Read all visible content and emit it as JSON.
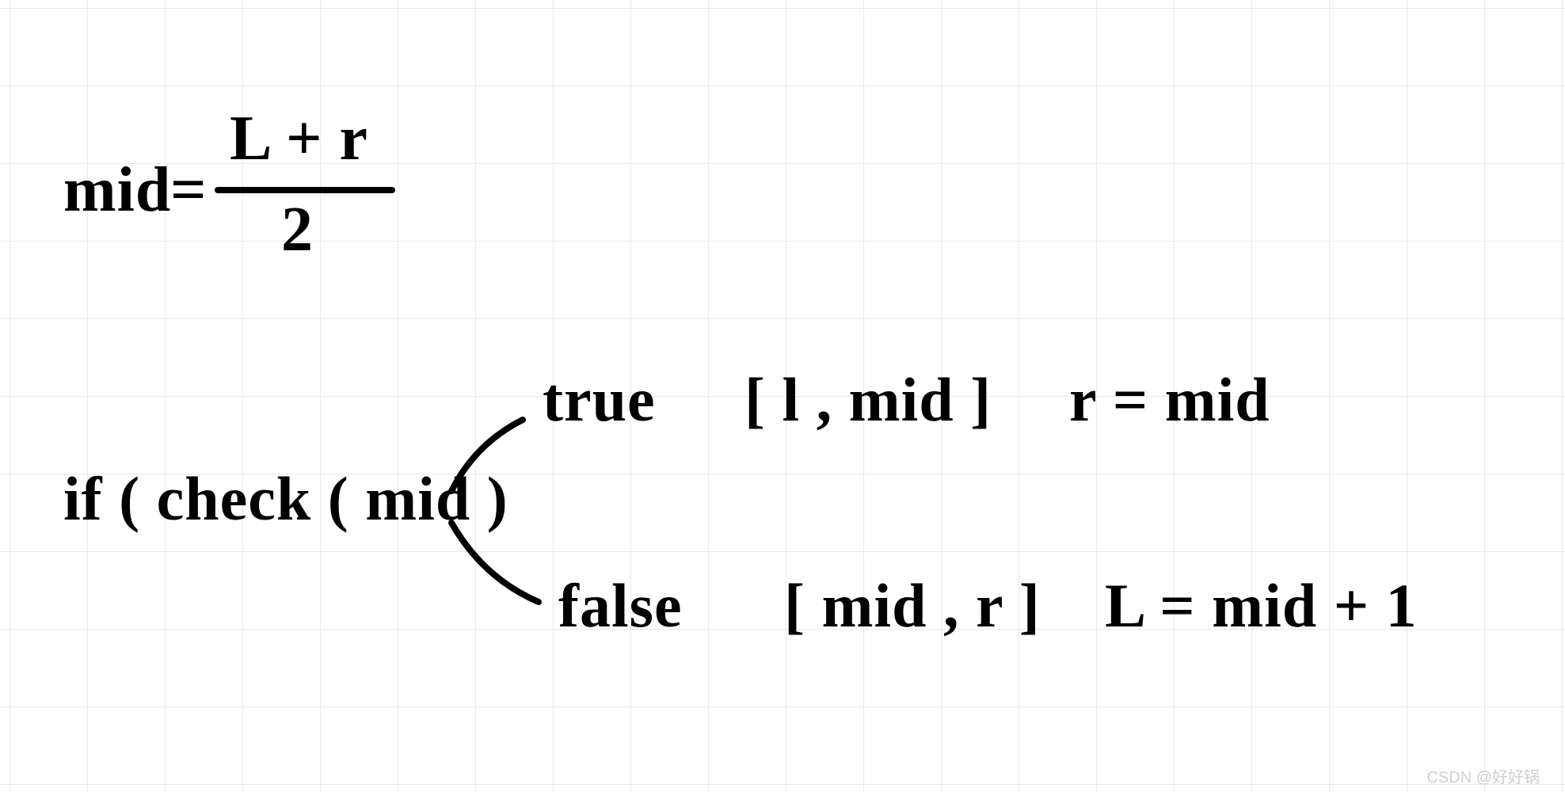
{
  "formula": {
    "lhs": "mid",
    "eq": "=",
    "numerator": "L + r",
    "denominator": "2"
  },
  "cond": {
    "if_text": "if ( check ( mid )"
  },
  "branch_true": {
    "label": "true",
    "interval": "[ l , mid ]",
    "update": "r = mid"
  },
  "branch_false": {
    "label": "false",
    "interval": "[ mid , r ]",
    "update": "L = mid + 1"
  },
  "watermark": "CSDN @好好锅"
}
